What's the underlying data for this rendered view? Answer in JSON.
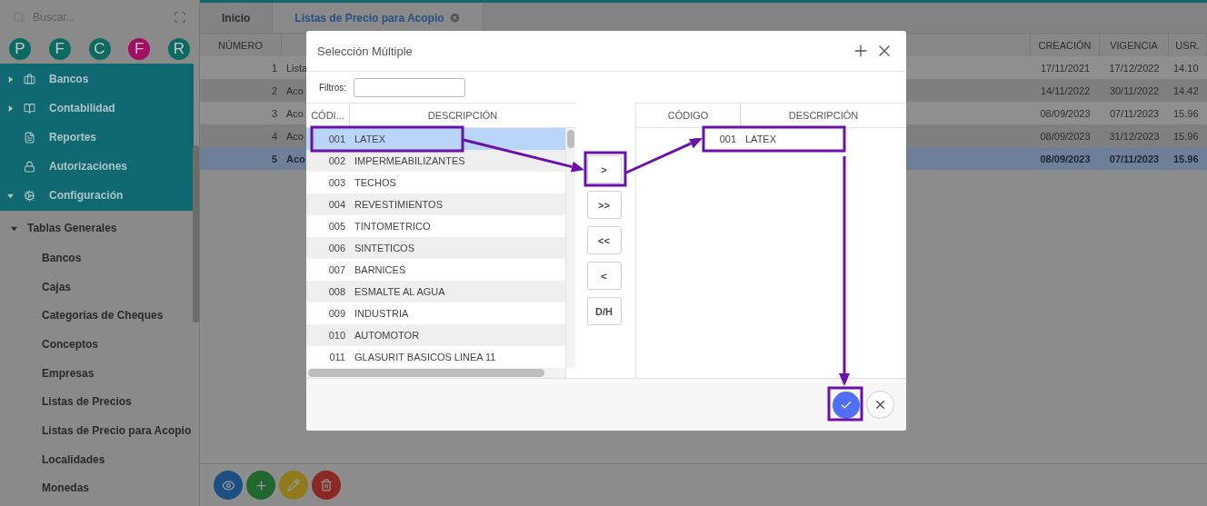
{
  "sidebar": {
    "search": {
      "placeholder": "Buscar..."
    },
    "shortcuts": [
      {
        "label": "P",
        "color": "#0b6b63"
      },
      {
        "label": "F",
        "color": "#0b6b63"
      },
      {
        "label": "C",
        "color": "#0b6b63"
      },
      {
        "label": "F",
        "color": "#a10d63"
      },
      {
        "label": "R",
        "color": "#0b6b63"
      }
    ],
    "menu": [
      {
        "label": "Bancos",
        "expanded": false
      },
      {
        "label": "Contabilidad",
        "expanded": false
      },
      {
        "label": "Reportes"
      },
      {
        "label": "Autorizaciones"
      },
      {
        "label": "Configuración",
        "expanded": true,
        "children": [
          {
            "label": "Tablas Generales",
            "expanded": true,
            "children": [
              {
                "label": "Bancos"
              },
              {
                "label": "Cajas"
              },
              {
                "label": "Categorías de Cheques"
              },
              {
                "label": "Conceptos"
              },
              {
                "label": "Empresas"
              },
              {
                "label": "Listas de Precios"
              },
              {
                "label": "Listas de Precio para Acopio"
              },
              {
                "label": "Localidades"
              },
              {
                "label": "Monedas"
              }
            ]
          }
        ]
      }
    ]
  },
  "tabs": [
    {
      "label": "Inicio",
      "selected": false,
      "closable": false
    },
    {
      "label": "Listas de Precio para Acopio",
      "selected": true,
      "closable": true
    }
  ],
  "table": {
    "headers": {
      "number": "NÚMERO",
      "created": "CREACIÓN",
      "valid_until": "VIGENCIA",
      "user": "USR."
    },
    "rows": [
      {
        "number": "1",
        "column_2": "Lista",
        "created": "17/11/2021",
        "valid_until": "17/12/2022",
        "user": "14.10",
        "selected": false
      },
      {
        "number": "2",
        "column_2": "Aco",
        "created": "14/11/2022",
        "valid_until": "30/11/2022",
        "user": "14.42",
        "selected": false
      },
      {
        "number": "3",
        "column_2": "Aco",
        "created": "08/09/2023",
        "valid_until": "07/11/2023",
        "user": "15.96",
        "selected": false
      },
      {
        "number": "4",
        "column_2": "Aco",
        "created": "08/09/2023",
        "valid_until": "31/12/2023",
        "user": "15.96",
        "selected": false
      },
      {
        "number": "5",
        "column_2": "Aco",
        "created": "08/09/2023",
        "valid_until": "07/11/2023",
        "user": "15.96",
        "selected": true
      }
    ]
  },
  "dialog": {
    "title": "Selección Múltiple",
    "filter": {
      "label": "Filtros:"
    },
    "available": {
      "columns": [
        "CÓDI...",
        "DESCRIPCIÓN"
      ],
      "rows": [
        {
          "code": "001",
          "description": "LATEX",
          "selected": true
        },
        {
          "code": "002",
          "description": "IMPERMEABILIZANTES",
          "selected": false
        },
        {
          "code": "003",
          "description": "TECHOS",
          "selected": false
        },
        {
          "code": "004",
          "description": "REVESTIMIENTOS",
          "selected": false
        },
        {
          "code": "005",
          "description": "TINTOMETRICO",
          "selected": false
        },
        {
          "code": "006",
          "description": "SINTETICOS",
          "selected": false
        },
        {
          "code": "007",
          "description": "BARNICES",
          "selected": false
        },
        {
          "code": "008",
          "description": "ESMALTE AL AGUA",
          "selected": false
        },
        {
          "code": "009",
          "description": "INDUSTRIA",
          "selected": false
        },
        {
          "code": "010",
          "description": "AUTOMOTOR",
          "selected": false
        },
        {
          "code": "011",
          "description": "GLASURIT BASICOS LINEA 11",
          "selected": false
        }
      ]
    },
    "move_buttons": [
      ">",
      ">>",
      "<<",
      "<",
      "D/H"
    ],
    "chosen": {
      "columns": [
        "CÓDIGO",
        "DESCRIPCIÓN"
      ],
      "rows": [
        {
          "code": "001",
          "description": "LATEX"
        }
      ]
    }
  }
}
